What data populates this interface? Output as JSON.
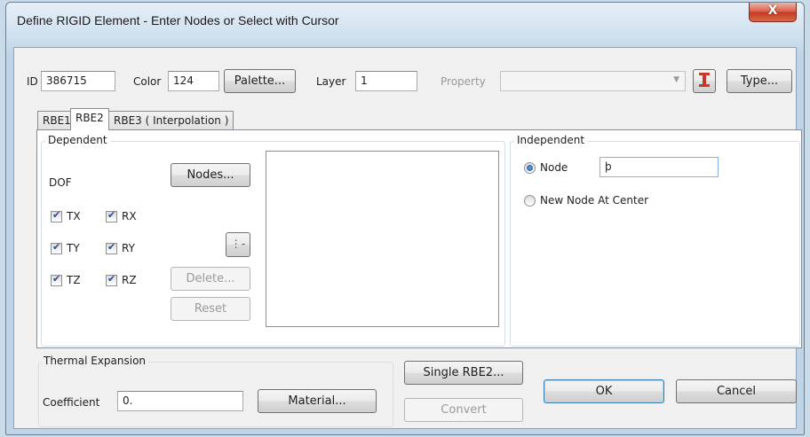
{
  "window": {
    "title": "Define RIGID Element - Enter Nodes or Select with Cursor",
    "close": "X"
  },
  "top": {
    "id_label": "ID",
    "id_value": "386715",
    "color_label": "Color",
    "color_value": "124",
    "palette_button": "Palette...",
    "layer_label": "Layer",
    "layer_value": "1",
    "property_label": "Property",
    "property_value": "",
    "type_button": "Type..."
  },
  "tabs": [
    {
      "label": "RBE1"
    },
    {
      "label": "RBE2"
    },
    {
      "label": "RBE3 ( Interpolation )"
    }
  ],
  "dependent": {
    "group_title": "Dependent",
    "dof_label": "DOF",
    "nodes_button": "Nodes...",
    "delete_button": "Delete...",
    "reset_button": "Reset",
    "dofs": [
      {
        "label": "TX",
        "checked": true
      },
      {
        "label": "RX",
        "checked": true
      },
      {
        "label": "TY",
        "checked": true
      },
      {
        "label": "RY",
        "checked": true
      },
      {
        "label": "TZ",
        "checked": true
      },
      {
        "label": "RZ",
        "checked": true
      }
    ]
  },
  "independent": {
    "group_title": "Independent",
    "node_label": "Node",
    "node_value": "þ",
    "new_node_label": "New Node At Center"
  },
  "thermal": {
    "group_title": "Thermal Expansion",
    "coefficient_label": "Coefficient",
    "coefficient_value": "0.",
    "material_button": "Material..."
  },
  "bottom": {
    "single_button": "Single RBE2...",
    "convert_button": "Convert",
    "ok_button": "OK",
    "cancel_button": "Cancel"
  },
  "colors": {
    "titlebar": "#cfe0ef",
    "close": "#c43a22",
    "panel": "#f0f0f0",
    "icon_red": "#c8372a"
  }
}
